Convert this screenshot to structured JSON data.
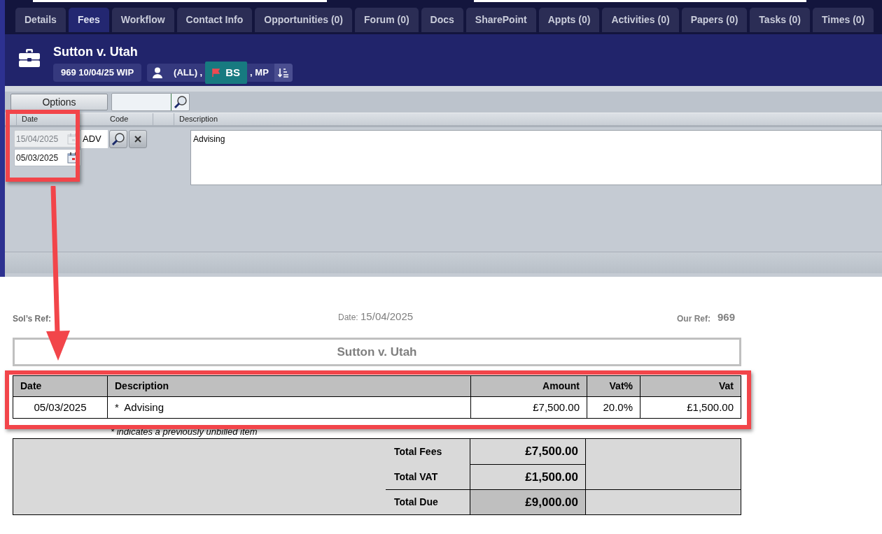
{
  "tabs": [
    {
      "label": "Details",
      "selected": false
    },
    {
      "label": "Fees",
      "selected": true
    },
    {
      "label": "Workflow",
      "selected": false
    },
    {
      "label": "Contact Info",
      "selected": false
    },
    {
      "label": "Opportunities (0)",
      "selected": false
    },
    {
      "label": "Forum (0)",
      "selected": false
    },
    {
      "label": "Docs",
      "selected": false
    },
    {
      "label": "SharePoint",
      "selected": false
    },
    {
      "label": "Appts (0)",
      "selected": false
    },
    {
      "label": "Activities (0)",
      "selected": false
    },
    {
      "label": "Papers (0)",
      "selected": false
    },
    {
      "label": "Tasks (0)",
      "selected": false
    },
    {
      "label": "Times (0)",
      "selected": false
    }
  ],
  "matter": {
    "title": "Sutton v. Utah",
    "ref_chip": "969 10/04/25 WIP",
    "assignees": [
      {
        "label": "(ALL) ,",
        "highlighted": false
      },
      {
        "label": "BS",
        "highlighted": true
      },
      {
        "label": ", MP",
        "highlighted": false
      }
    ]
  },
  "toolbar": {
    "options_button": "Options"
  },
  "entry": {
    "columns": [
      "Date",
      "Code",
      "Description"
    ],
    "dates": [
      {
        "value": "15/04/2025",
        "disabled": true
      },
      {
        "value": "05/03/2025",
        "disabled": false
      }
    ],
    "code": "ADV",
    "description": "Advising"
  },
  "document": {
    "sols_ref_label": "Sol’s Ref:",
    "date_label": "Date:",
    "date": "15/04/2025",
    "our_ref_label": "Our Ref:",
    "our_ref": "969",
    "title": "Sutton v. Utah",
    "table": {
      "columns": [
        "Date",
        "Description",
        "Amount",
        "Vat%",
        "Vat"
      ],
      "rows": [
        [
          "05/03/2025",
          "*  Advising",
          "£7,500.00",
          "20.0%",
          "£1,500.00"
        ]
      ]
    },
    "footnote": "* indicates a previously unbilled item",
    "totals": [
      {
        "label": "Total Fees",
        "value": "£7,500.00",
        "highlighted": false
      },
      {
        "label": "Total VAT",
        "value": "£1,500.00",
        "highlighted": false
      },
      {
        "label": "Total Due",
        "value": "£9,000.00",
        "highlighted": true
      }
    ]
  }
}
